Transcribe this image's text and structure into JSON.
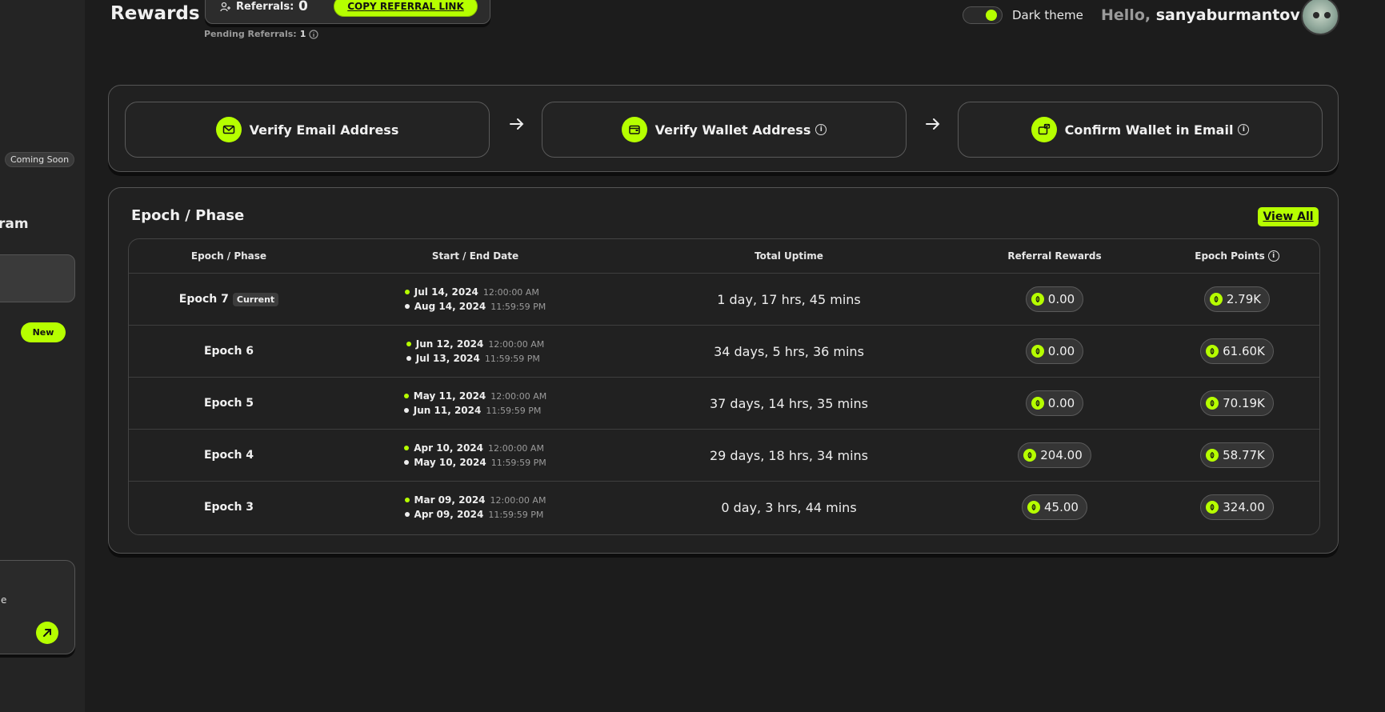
{
  "sidebar": {
    "coming_soon": "Coming Soon",
    "program_fragment": "ram",
    "new_badge": "New",
    "card_fragment": "e"
  },
  "header": {
    "title": "Rewards",
    "referrals_label": "Referrals:",
    "referrals_count": "0",
    "copy_referral_label": "COPY REFERRAL LINK",
    "pending_label": "Pending Referrals:",
    "pending_value": "1",
    "theme_label": "Dark theme",
    "hello_prefix": "Hello,",
    "username": "sanyaburmantov!"
  },
  "steps": [
    {
      "label": "Verify Email Address",
      "icon": "envelope-icon",
      "info": false
    },
    {
      "label": "Verify Wallet Address",
      "icon": "wallet-icon",
      "info": true
    },
    {
      "label": "Confirm Wallet in Email",
      "icon": "wallet-mail-icon",
      "info": true
    }
  ],
  "table": {
    "title": "Epoch / Phase",
    "view_all": "View All",
    "headers": [
      "Epoch / Phase",
      "Start / End Date",
      "Total Uptime",
      "Referral Rewards",
      "Epoch Points"
    ],
    "rows": [
      {
        "epoch": "Epoch 7",
        "tag": "Current",
        "start_date": "Jul 14, 2024",
        "start_time": "12:00:00 AM",
        "end_date": "Aug 14, 2024",
        "end_time": "11:59:59 PM",
        "uptime": "1 day, 17 hrs, 45 mins",
        "referral_rewards": "0.00",
        "epoch_points": "2.79K"
      },
      {
        "epoch": "Epoch 6",
        "tag": "",
        "start_date": "Jun 12, 2024",
        "start_time": "12:00:00 AM",
        "end_date": "Jul 13, 2024",
        "end_time": "11:59:59 PM",
        "uptime": "34 days, 5 hrs, 36 mins",
        "referral_rewards": "0.00",
        "epoch_points": "61.60K"
      },
      {
        "epoch": "Epoch 5",
        "tag": "",
        "start_date": "May 11, 2024",
        "start_time": "12:00:00 AM",
        "end_date": "Jun 11, 2024",
        "end_time": "11:59:59 PM",
        "uptime": "37 days, 14 hrs, 35 mins",
        "referral_rewards": "0.00",
        "epoch_points": "70.19K"
      },
      {
        "epoch": "Epoch 4",
        "tag": "",
        "start_date": "Apr 10, 2024",
        "start_time": "12:00:00 AM",
        "end_date": "May 10, 2024",
        "end_time": "11:59:59 PM",
        "uptime": "29 days, 18 hrs, 34 mins",
        "referral_rewards": "204.00",
        "epoch_points": "58.77K"
      },
      {
        "epoch": "Epoch 3",
        "tag": "",
        "start_date": "Mar 09, 2024",
        "start_time": "12:00:00 AM",
        "end_date": "Apr 09, 2024",
        "end_time": "11:59:59 PM",
        "uptime": "0 day, 3 hrs, 44 mins",
        "referral_rewards": "45.00",
        "epoch_points": "324.00"
      }
    ]
  },
  "colors": {
    "accent": "#b6ff00",
    "background": "#1c1c1c",
    "sidebar": "#242424",
    "panel": "#212121"
  }
}
